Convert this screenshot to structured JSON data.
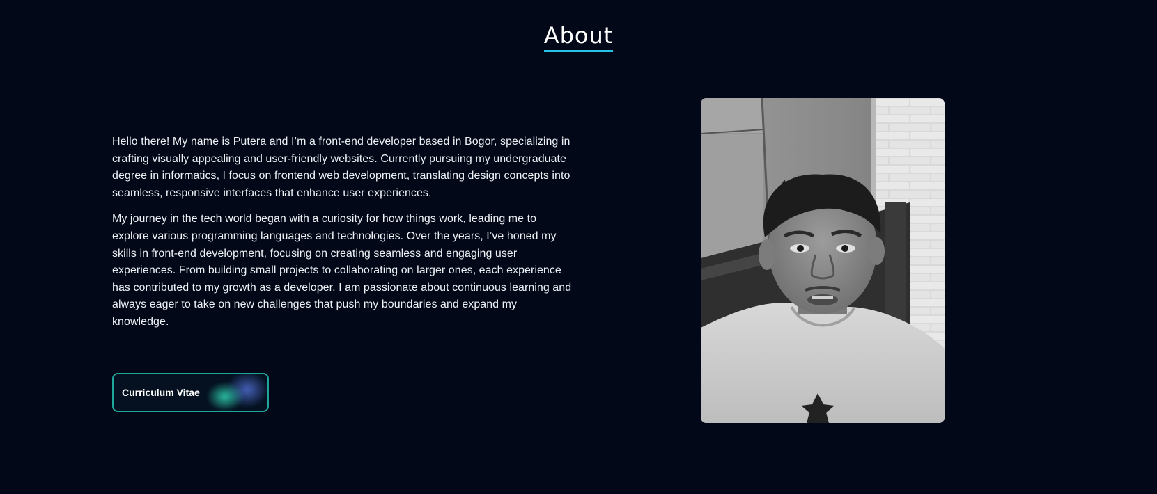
{
  "section": {
    "title": "About"
  },
  "about": {
    "paragraphs": [
      "Hello there! My name is Putera and I’m a front-end developer based in Bogor, specializing in crafting visually appealing and user-friendly websites. Currently pursuing my undergraduate degree in informatics, I focus on frontend web development, translating design concepts into seamless, responsive interfaces that enhance user experiences.",
      "My journey in the tech world began with a curiosity for how things work, leading me to explore various programming languages and technologies. Over the years, I’ve honed my skills in front-end development, focusing on creating seamless and engaging user experiences. From building small projects to collaborating on larger ones, each experience has contributed to my growth as a developer. I am passionate about continuous learning and always eager to take on new challenges that push my boundaries and expand my knowledge."
    ],
    "cv_button_label": "Curriculum Vitae"
  },
  "colors": {
    "background": "#020817",
    "accent": "#22c3e6",
    "button_border": "#1fa59a"
  },
  "photo": {
    "subject": "profile-photo"
  }
}
